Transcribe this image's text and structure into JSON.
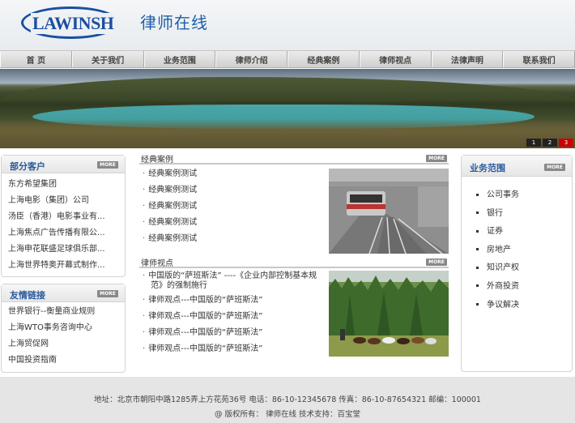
{
  "header": {
    "logo_text": "LAWINSH",
    "site_name": "律师在线"
  },
  "nav": [
    "首 页",
    "关于我们",
    "业务范围",
    "律师介绍",
    "经典案例",
    "律师视点",
    "法律声明",
    "联系我们"
  ],
  "banner": {
    "pager": [
      "1",
      "2",
      "3"
    ],
    "active_page": "3"
  },
  "more_label": "MORE",
  "clients": {
    "title": "部分客户",
    "items": [
      "东方希望集团",
      "上海电影（集团）公司",
      "汤臣（香港）电影事业有...",
      "上海焦点广告传播有限公...",
      "上海申花联盛足球俱乐部...",
      "上海世界特奥开幕式制作..."
    ]
  },
  "links": {
    "title": "友情链接",
    "items": [
      "世界银行--衡量商业规则",
      "上海WTO事务咨询中心",
      "上海贸促网",
      "中国投资指南"
    ]
  },
  "cases": {
    "title": "经典案例",
    "items": [
      "经典案例测试",
      "经典案例测试",
      "经典案例测试",
      "经典案例测试",
      "经典案例测试"
    ]
  },
  "views": {
    "title": "律师视点",
    "items": [
      "中国版的“萨班斯法” ----《企业内部控制基本规范》的强制施行",
      "律师观点---中国版的“萨班斯法”",
      "律师观点---中国版的“萨班斯法”",
      "律师观点---中国版的“萨班斯法”",
      "律师观点---中国版的“萨班斯法”"
    ]
  },
  "services": {
    "title": "业务范围",
    "items": [
      "公司事务",
      "银行",
      "证券",
      "房地产",
      "知识产权",
      "外商投资",
      "争议解决"
    ]
  },
  "footer": {
    "address": "地址：北京市朝阳中路1285弄上方花苑36号   电话：86-10-12345678  传真：86-10-87654321  邮编：100001",
    "copyright": "@ 版权所有： 律师在线  技术支持：百宝堂"
  },
  "colors": {
    "accent": "#1e5ea8",
    "title_blue": "#2a5a9c",
    "active_pager": "#cc0000",
    "footer_bg": "#e5e5e5"
  }
}
